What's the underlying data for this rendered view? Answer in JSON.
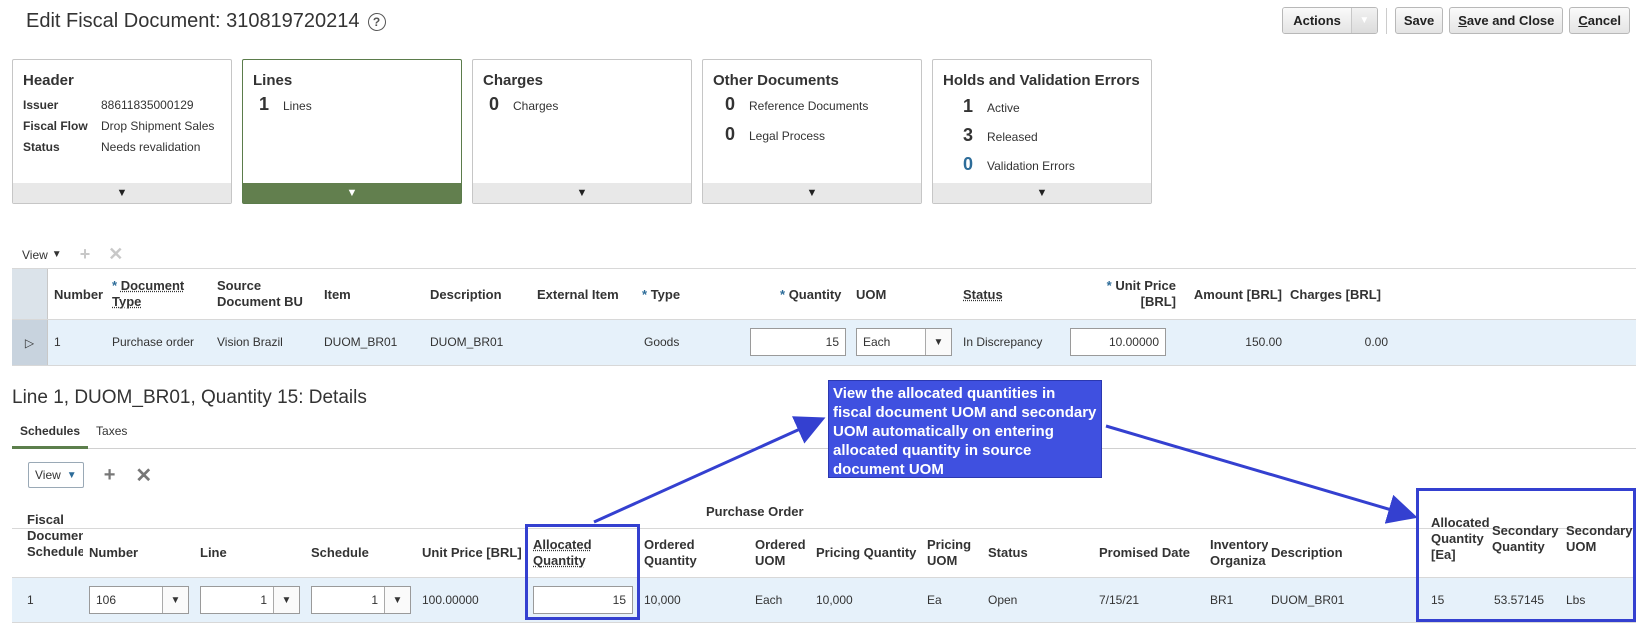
{
  "page": {
    "title": "Edit Fiscal Document: 310819720214",
    "help_icon": "?"
  },
  "actions": {
    "actions_label": "Actions",
    "save_label": "Save",
    "save_close_prefix": "S",
    "save_close_rest": "ave and Close",
    "cancel_prefix": "C",
    "cancel_rest": "ancel"
  },
  "tiles": {
    "header": {
      "title": "Header",
      "rows": [
        {
          "key": "Issuer",
          "value": "88611835000129"
        },
        {
          "key": "Fiscal Flow",
          "value": "Drop Shipment Sales"
        },
        {
          "key": "Status",
          "value": "Needs revalidation"
        }
      ]
    },
    "lines": {
      "title": "Lines",
      "count": "1",
      "label": "Lines"
    },
    "charges": {
      "title": "Charges",
      "count": "0",
      "label": "Charges"
    },
    "other_documents": {
      "title": "Other Documents",
      "items": [
        {
          "count": "0",
          "label": "Reference Documents"
        },
        {
          "count": "0",
          "label": "Legal Process"
        }
      ]
    },
    "holds": {
      "title": "Holds and Validation Errors",
      "items": [
        {
          "count": "1",
          "label": "Active"
        },
        {
          "count": "3",
          "label": "Released"
        },
        {
          "count": "0",
          "label": "Validation Errors"
        }
      ]
    },
    "expand_glyph": "▼"
  },
  "lines_table": {
    "view_label": "View",
    "headers": {
      "number": "Number",
      "doc_type_1": "Document",
      "doc_type_2": "Type",
      "source_bu_1": "Source",
      "source_bu_2": "Document BU",
      "item": "Item",
      "description": "Description",
      "external_item": "External Item",
      "type": "Type",
      "quantity": "Quantity",
      "uom": "UOM",
      "status": "Status",
      "unit_price_1": "Unit Price",
      "unit_price_2": "[BRL]",
      "amount": "Amount [BRL]",
      "charges": "Charges [BRL]"
    },
    "required_mark": "*",
    "row": {
      "number": "1",
      "doc_type": "Purchase order",
      "source_bu": "Vision Brazil",
      "item": "DUOM_BR01",
      "description": "DUOM_BR01",
      "type": "Goods",
      "quantity": "15",
      "uom": "Each",
      "status": "In Discrepancy",
      "unit_price": "10.00000",
      "amount": "150.00",
      "charges": "0.00"
    }
  },
  "details": {
    "title": "Line 1, DUOM_BR01, Quantity 15: Details",
    "tabs": [
      "Schedules",
      "Taxes"
    ],
    "view_label": "View"
  },
  "schedules_table": {
    "group_header": "Purchase Order",
    "headers": {
      "fiscal_1": "Fiscal",
      "fiscal_2": "Documen",
      "fiscal_3": "Schedule",
      "number": "Number",
      "line": "Line",
      "schedule": "Schedule",
      "unit_price": "Unit Price [BRL]",
      "allocated_1": "Allocated",
      "allocated_2": "Quantity",
      "ordered_qty_1": "Ordered",
      "ordered_qty_2": "Quantity",
      "ordered_uom_1": "Ordered",
      "ordered_uom_2": "UOM",
      "pricing_qty": "Pricing Quantity",
      "pricing_uom_1": "Pricing",
      "pricing_uom_2": "UOM",
      "status": "Status",
      "promised_date": "Promised Date",
      "inventory_1": "Inventory",
      "inventory_2": "Organiza",
      "description": "Description",
      "alloc_ea_1": "Allocated",
      "alloc_ea_2": "Quantity",
      "alloc_ea_3": "[Ea]",
      "secondary_qty_1": "Secondary",
      "secondary_qty_2": "Quantity",
      "secondary_uom_1": "Secondary",
      "secondary_uom_2": "UOM"
    },
    "row": {
      "fiscal_schedule": "1",
      "number": "106",
      "line": "1",
      "schedule": "1",
      "unit_price": "100.00000",
      "allocated_quantity": "15",
      "ordered_quantity": "10,000",
      "ordered_uom": "Each",
      "pricing_quantity": "10,000",
      "pricing_uom": "Ea",
      "status": "Open",
      "promised_date": "7/15/21",
      "inventory_org": "BR1",
      "description": "DUOM_BR01",
      "allocated_ea": "15",
      "secondary_quantity": "53.57145",
      "secondary_uom": "Lbs"
    }
  },
  "callout": {
    "text": "View the allocated quantities in fiscal document UOM and secondary UOM automatically on entering allocated quantity in source document UOM",
    "color": "#3f50e0"
  }
}
